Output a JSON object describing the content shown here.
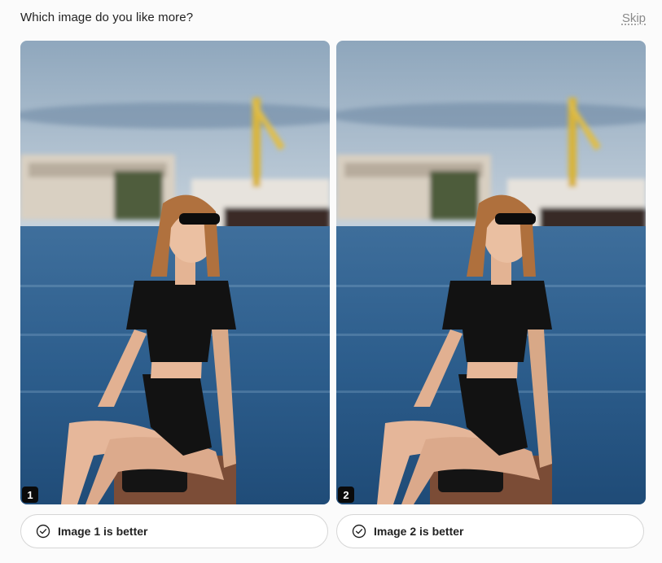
{
  "header": {
    "prompt": "Which image do you like more?",
    "skip_label": "Skip"
  },
  "options": [
    {
      "number": "1",
      "button_label": "Image 1 is better"
    },
    {
      "number": "2",
      "button_label": "Image 2 is better"
    }
  ],
  "colors": {
    "badge_bg": "#0a0a0a",
    "button_border": "#d6d6d6",
    "skip_text": "#8a8a8a"
  },
  "icons": {
    "choice_icon": "check-circle-icon"
  }
}
